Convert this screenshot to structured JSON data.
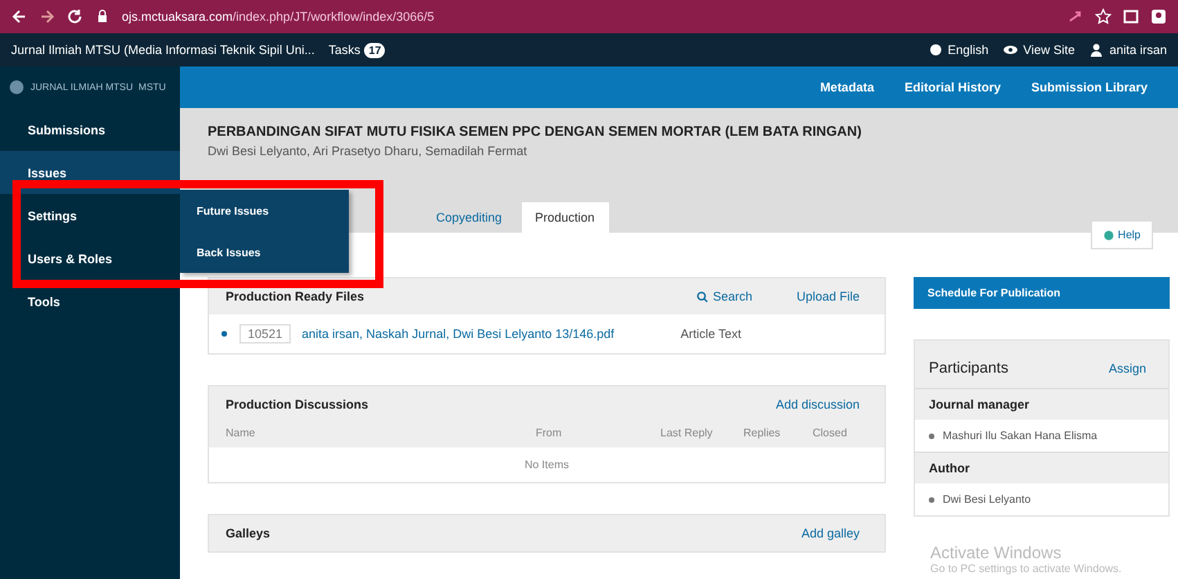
{
  "browser": {
    "url_host": "ojs.mctuaksara.com",
    "url_path": "/index.php/JT/workflow/index/3066/5"
  },
  "topbar": {
    "journal": "Jurnal Ilmiah MTSU (Media Informasi Teknik Sipil Uni...",
    "tasks_label": "Tasks",
    "tasks_count": "17",
    "language": "English",
    "view_site": "View Site",
    "user": "anita irsan"
  },
  "header": {
    "logo_text": "JURNAL ILMIAH MTSU",
    "logo_sub": "MSTU",
    "links": [
      "Metadata",
      "Editorial History",
      "Submission Library"
    ]
  },
  "sidebar": {
    "items": [
      {
        "label": "Submissions",
        "selected": false
      },
      {
        "label": "Issues",
        "selected": true
      },
      {
        "label": "Settings",
        "selected": false
      },
      {
        "label": "Users & Roles",
        "selected": false
      },
      {
        "label": "Tools",
        "selected": false
      }
    ],
    "submenu": [
      "Future Issues",
      "Back Issues"
    ]
  },
  "submission": {
    "title": "PERBANDINGAN SIFAT MUTU FISIKA SEMEN PPC DENGAN SEMEN MORTAR (LEM BATA RINGAN)",
    "authors": "Dwi Besi Lelyanto, Ari Prasetyo Dharu, Semadilah Fermat"
  },
  "tabs": [
    {
      "label": "Copyediting",
      "selected": false
    },
    {
      "label": "Production",
      "selected": true
    }
  ],
  "help": "Help",
  "ready_files": {
    "title": "Production Ready Files",
    "search": "Search",
    "upload": "Upload File",
    "files": [
      {
        "id": "10521",
        "name": "anita irsan, Naskah Jurnal, Dwi Besi Lelyanto 13/146.pdf",
        "type": "Article Text"
      }
    ]
  },
  "discussions": {
    "title": "Production Discussions",
    "add": "Add discussion",
    "columns": [
      "Name",
      "From",
      "Last Reply",
      "Replies",
      "Closed"
    ],
    "empty": "No Items"
  },
  "galleys": {
    "title": "Galleys",
    "add": "Add galley"
  },
  "schedule": "Schedule For Publication",
  "participants": {
    "title": "Participants",
    "assign": "Assign",
    "groups": [
      {
        "role": "Journal manager",
        "members": [
          "Mashuri Ilu Sakan Hana Elisma"
        ]
      },
      {
        "role": "Author",
        "members": [
          "Dwi Besi Lelyanto"
        ]
      }
    ]
  },
  "os_notice": {
    "title": "Activate Windows",
    "text": "Go to PC settings to activate Windows."
  }
}
